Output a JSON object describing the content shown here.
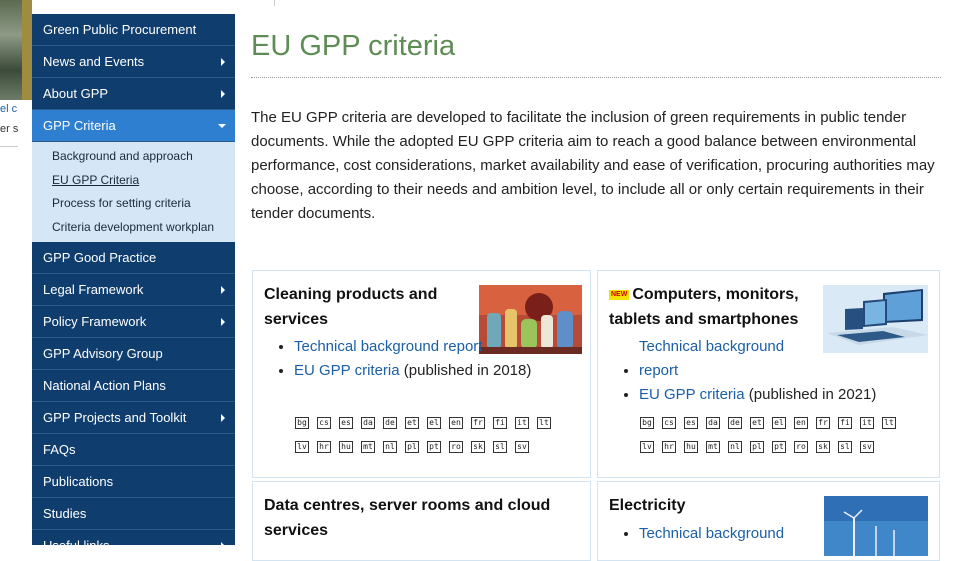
{
  "background": {
    "text1": "el c",
    "text2": "er s"
  },
  "sidebar": {
    "items": [
      {
        "label": "Green Public Procurement",
        "arrow": false
      },
      {
        "label": "News and Events",
        "arrow": true
      },
      {
        "label": "About GPP",
        "arrow": true
      },
      {
        "label": "GPP Criteria",
        "arrow": true,
        "active": true
      },
      {
        "label": "GPP Good Practice",
        "arrow": false
      },
      {
        "label": "Legal Framework",
        "arrow": true
      },
      {
        "label": "Policy Framework",
        "arrow": true
      },
      {
        "label": "GPP Advisory Group",
        "arrow": false
      },
      {
        "label": "National Action Plans",
        "arrow": false
      },
      {
        "label": "GPP Projects and Toolkit",
        "arrow": true
      },
      {
        "label": "FAQs",
        "arrow": false
      },
      {
        "label": "Publications",
        "arrow": false
      },
      {
        "label": "Studies",
        "arrow": false
      },
      {
        "label": "Useful links",
        "arrow": true
      }
    ],
    "subitems": [
      "Background and approach",
      "EU GPP Criteria",
      "Process for setting criteria",
      "Criteria development workplan"
    ]
  },
  "main": {
    "title": "EU GPP criteria",
    "intro": "The EU GPP criteria are developed to facilitate the inclusion of green requirements in public tender documents. While the adopted EU GPP criteria aim to reach a good balance between environmental performance, cost considerations, market availability and ease of verification, procuring authorities may choose, according to their needs and ambition level, to include all or only certain requirements in their tender documents."
  },
  "cards": [
    {
      "title": "Cleaning products and services",
      "tech_link": "Technical background report",
      "criteria_link": "EU GPP criteria",
      "published": " (published in 2018)",
      "langs_row1": [
        "bg",
        "cs",
        "es",
        "da",
        "de",
        "et",
        "el",
        "en",
        "fr",
        "fi",
        "it",
        "lt"
      ],
      "langs_row2": [
        "lv",
        "hr",
        "hu",
        "mt",
        "nl",
        "pl",
        "pt",
        "ro",
        "sk",
        "sl",
        "sv"
      ]
    },
    {
      "badge": "NEW",
      "title": "Computers, monitors, tablets and smartphones",
      "tech_link": "Technical background report",
      "criteria_link": "EU GPP criteria",
      "published": " (published in 2021)",
      "langs_row1": [
        "bg",
        "cs",
        "es",
        "da",
        "de",
        "et",
        "el",
        "en",
        "fr",
        "fi",
        "it",
        "lt"
      ],
      "langs_row2": [
        "lv",
        "hr",
        "hu",
        "mt",
        "nl",
        "pl",
        "pt",
        "ro",
        "sk",
        "sl",
        "sv"
      ]
    },
    {
      "title": "Data centres, server rooms and cloud services"
    },
    {
      "title": "Electricity",
      "tech_link": "Technical background"
    }
  ]
}
